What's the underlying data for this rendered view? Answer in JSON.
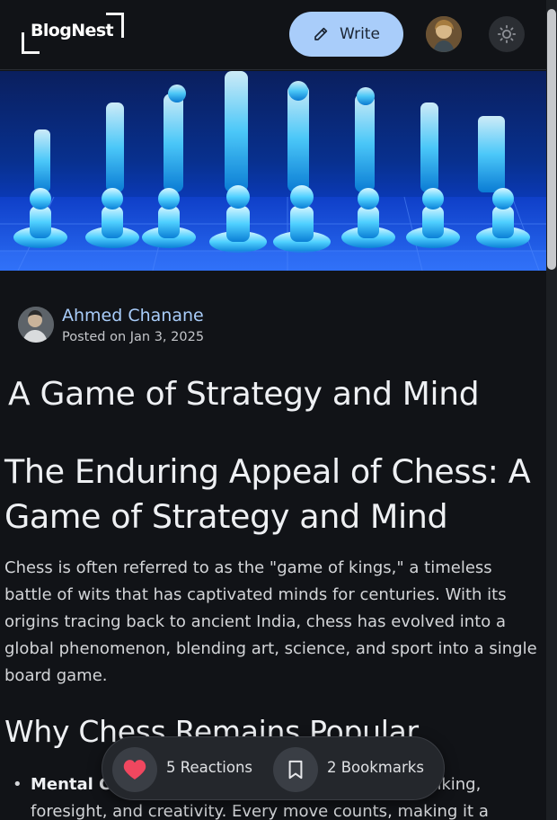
{
  "header": {
    "logo_text": "BlogNest",
    "write_label": "Write"
  },
  "article": {
    "author_name": "Ahmed Chanane",
    "posted_on": "Posted on Jan 3, 2025",
    "title": "A Game of Strategy and Mind",
    "heading": "The Enduring Appeal of Chess: A Game of Strategy and Mind",
    "intro": "Chess is often referred to as the \"game of kings,\" a timeless battle of wits that has captivated minds for centuries. With its origins tracing back to ancient India, chess has evolved into a global phenomenon, blending art, science, and sport into a single board game.",
    "subheading": "Why Chess Remains Popular",
    "list_items": [
      {
        "bold": "Mental Challenge:",
        "text": " Chess sharpens strategic thinking, foresight, and creativity. Every move counts, making it a"
      }
    ]
  },
  "reactions": {
    "reactions_label": "5 Reactions",
    "bookmarks_label": "2 Bookmarks"
  },
  "colors": {
    "background": "#111317",
    "accent": "#a9cdfa",
    "heart": "#f0475f",
    "cover_blue": "#0b3cc2"
  },
  "icons": {
    "write": "pencil-icon",
    "theme": "sun-icon",
    "reaction": "heart-icon",
    "bookmark": "bookmark-icon"
  }
}
